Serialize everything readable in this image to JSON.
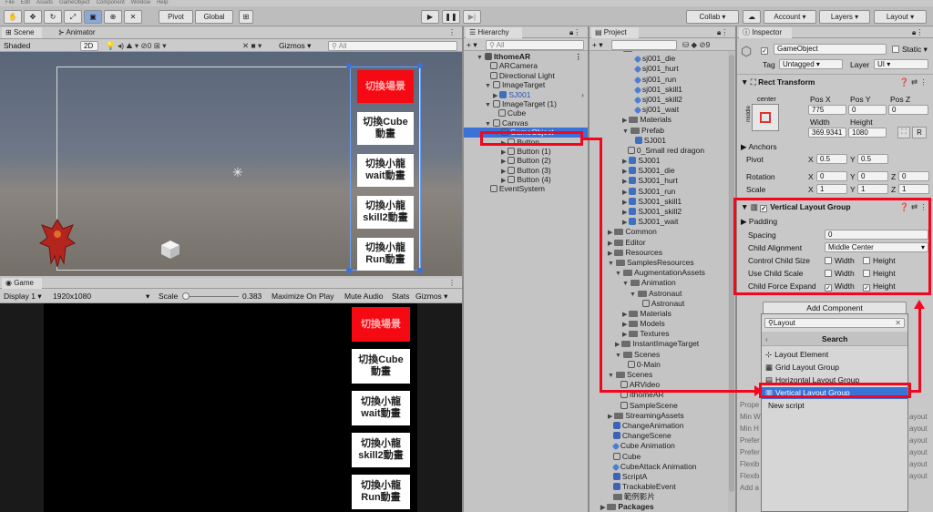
{
  "menubar": [
    "File",
    "Edit",
    "Assets",
    "GameObject",
    "Component",
    "Window",
    "Help"
  ],
  "toolbar": {
    "pivot": "Pivot",
    "global": "Global",
    "collab": "Collab ▾",
    "account": "Account ▾",
    "layers": "Layers ▾",
    "layout": "Layout ▾"
  },
  "scene_panel": {
    "tab_scene": "Scene",
    "tab_animator": "Animator",
    "shading": "Shaded",
    "mode_2d": "2D",
    "gizmos": "Gizmos ▾",
    "search_placeholder": "All",
    "buttons": [
      {
        "label": "切換場景",
        "red": true
      },
      {
        "label": "切換Cube\n動畫",
        "red": false
      },
      {
        "label": "切換小龍\nwait動畫",
        "red": false
      },
      {
        "label": "切換小龍\nskill2動畫",
        "red": false
      },
      {
        "label": "切換小龍\nRun動畫",
        "red": false
      }
    ]
  },
  "game_panel": {
    "tab": "Game",
    "display": "Display 1 ▾",
    "resolution": "1920x1080",
    "scale_label": "Scale",
    "scale_value": "0.383",
    "maximize": "Maximize On Play",
    "mute": "Mute Audio",
    "stats": "Stats",
    "gizmos": "Gizmos ▾",
    "buttons": [
      {
        "label": "切換場景",
        "red": true
      },
      {
        "label": "切換Cube\n動畫",
        "red": false
      },
      {
        "label": "切換小龍\nwait動畫",
        "red": false
      },
      {
        "label": "切換小龍\nskill2動畫",
        "red": false
      },
      {
        "label": "切換小龍\nRun動畫",
        "red": false
      }
    ]
  },
  "hierarchy": {
    "tab": "Hierarchy",
    "search_placeholder": "All",
    "items": [
      {
        "label": "IthomeAR",
        "indent": 0,
        "icon": "unity-scene-icon",
        "arrow": "▼",
        "bold": true
      },
      {
        "label": "ARCamera",
        "indent": 1,
        "icon": "gameobject-icon",
        "arrow": ""
      },
      {
        "label": "Directional Light",
        "indent": 1,
        "icon": "gameobject-icon",
        "arrow": ""
      },
      {
        "label": "ImageTarget",
        "indent": 1,
        "icon": "gameobject-icon",
        "arrow": "▼"
      },
      {
        "label": "SJ001",
        "indent": 2,
        "icon": "prefab-icon",
        "arrow": "▶",
        "blue": true
      },
      {
        "label": "ImageTarget (1)",
        "indent": 1,
        "icon": "gameobject-icon",
        "arrow": "▼"
      },
      {
        "label": "Cube",
        "indent": 2,
        "icon": "gameobject-icon",
        "arrow": ""
      },
      {
        "label": "Canvas",
        "indent": 1,
        "icon": "gameobject-icon",
        "arrow": "▼"
      },
      {
        "label": "GameObject",
        "indent": 2,
        "icon": "gameobject-icon",
        "arrow": "▼",
        "selected": true
      },
      {
        "label": "Button",
        "indent": 3,
        "icon": "gameobject-icon",
        "arrow": "▶"
      },
      {
        "label": "Button (1)",
        "indent": 3,
        "icon": "gameobject-icon",
        "arrow": "▶"
      },
      {
        "label": "Button (2)",
        "indent": 3,
        "icon": "gameobject-icon",
        "arrow": "▶"
      },
      {
        "label": "Button (3)",
        "indent": 3,
        "icon": "gameobject-icon",
        "arrow": "▶"
      },
      {
        "label": "Button (4)",
        "indent": 3,
        "icon": "gameobject-icon",
        "arrow": "▶"
      },
      {
        "label": "EventSystem",
        "indent": 1,
        "icon": "gameobject-icon",
        "arrow": ""
      }
    ]
  },
  "project": {
    "tab": "Project",
    "items": [
      {
        "label": "Animation",
        "indent": 2,
        "type": "folder",
        "arrow": "▼"
      },
      {
        "label": "sj001_die",
        "indent": 4,
        "type": "anim"
      },
      {
        "label": "sj001_hurt",
        "indent": 4,
        "type": "anim"
      },
      {
        "label": "sj001_run",
        "indent": 4,
        "type": "anim"
      },
      {
        "label": "sj001_skill1",
        "indent": 4,
        "type": "anim"
      },
      {
        "label": "sj001_skill2",
        "indent": 4,
        "type": "anim"
      },
      {
        "label": "sj001_wait",
        "indent": 4,
        "type": "anim"
      },
      {
        "label": "Materials",
        "indent": 3,
        "type": "folder",
        "arrow": "▶"
      },
      {
        "label": "Prefab",
        "indent": 3,
        "type": "folder",
        "arrow": "▼"
      },
      {
        "label": "SJ001",
        "indent": 4,
        "type": "cube"
      },
      {
        "label": "0_Small red dragon",
        "indent": 3,
        "type": "scene"
      },
      {
        "label": "SJ001",
        "indent": 3,
        "type": "cube",
        "arrow": "▶"
      },
      {
        "label": "SJ001_die",
        "indent": 3,
        "type": "cube",
        "arrow": "▶"
      },
      {
        "label": "SJ001_hurt",
        "indent": 3,
        "type": "cube",
        "arrow": "▶"
      },
      {
        "label": "SJ001_run",
        "indent": 3,
        "type": "cube",
        "arrow": "▶"
      },
      {
        "label": "SJ001_skill1",
        "indent": 3,
        "type": "cube",
        "arrow": "▶"
      },
      {
        "label": "SJ001_skill2",
        "indent": 3,
        "type": "cube",
        "arrow": "▶"
      },
      {
        "label": "SJ001_wait",
        "indent": 3,
        "type": "cube",
        "arrow": "▶"
      },
      {
        "label": "Common",
        "indent": 1,
        "type": "folder",
        "arrow": "▶"
      },
      {
        "label": "Editor",
        "indent": 1,
        "type": "folder",
        "arrow": "▶"
      },
      {
        "label": "Resources",
        "indent": 1,
        "type": "folder",
        "arrow": "▶"
      },
      {
        "label": "SamplesResources",
        "indent": 1,
        "type": "folder",
        "arrow": "▼"
      },
      {
        "label": "AugmentationAssets",
        "indent": 2,
        "type": "folder",
        "arrow": "▼"
      },
      {
        "label": "Animation",
        "indent": 3,
        "type": "folder",
        "arrow": "▼"
      },
      {
        "label": "Astronaut",
        "indent": 4,
        "type": "folder",
        "arrow": "▼"
      },
      {
        "label": "Astronaut",
        "indent": 5,
        "type": "scene"
      },
      {
        "label": "Materials",
        "indent": 3,
        "type": "folder",
        "arrow": "▶"
      },
      {
        "label": "Models",
        "indent": 3,
        "type": "folder",
        "arrow": "▶"
      },
      {
        "label": "Textures",
        "indent": 3,
        "type": "folder",
        "arrow": "▶"
      },
      {
        "label": "InstantImageTarget",
        "indent": 2,
        "type": "folder",
        "arrow": "▶"
      },
      {
        "label": "Scenes",
        "indent": 2,
        "type": "folder",
        "arrow": "▼"
      },
      {
        "label": "0-Main",
        "indent": 3,
        "type": "scene"
      },
      {
        "label": "Scenes",
        "indent": 1,
        "type": "folder",
        "arrow": "▼"
      },
      {
        "label": "ARVideo",
        "indent": 2,
        "type": "scene"
      },
      {
        "label": "IthomeAR",
        "indent": 2,
        "type": "scene"
      },
      {
        "label": "SampleScene",
        "indent": 2,
        "type": "scene"
      },
      {
        "label": "StreamingAssets",
        "indent": 1,
        "type": "folder",
        "arrow": "▶"
      },
      {
        "label": "ChangeAnimation",
        "indent": 1,
        "type": "script"
      },
      {
        "label": "ChangeScene",
        "indent": 1,
        "type": "script"
      },
      {
        "label": "Cube Animation",
        "indent": 1,
        "type": "anim"
      },
      {
        "label": "Cube",
        "indent": 1,
        "type": "scene"
      },
      {
        "label": "CubeAttack Animation",
        "indent": 1,
        "type": "anim"
      },
      {
        "label": "ScriptA",
        "indent": 1,
        "type": "script"
      },
      {
        "label": "TrackableEvent",
        "indent": 1,
        "type": "script"
      },
      {
        "label": "範例影片",
        "indent": 1,
        "type": "video"
      },
      {
        "label": "Packages",
        "indent": 0,
        "type": "folder",
        "arrow": "▶",
        "bold": true
      }
    ]
  },
  "inspector": {
    "tab": "Inspector",
    "object_name": "GameObject",
    "static_label": "Static ▾",
    "tag_label": "Tag",
    "tag_value": "Untagged",
    "layer_label": "Layer",
    "layer_value": "UI",
    "rect_transform": {
      "title": "Rect Transform",
      "anchor_label": "center",
      "side_label": "middle",
      "pos_x_label": "Pos X",
      "pos_x": "775",
      "pos_y_label": "Pos Y",
      "pos_y": "0",
      "pos_z_label": "Pos Z",
      "pos_z": "0",
      "width_label": "Width",
      "width": "369.9341",
      "height_label": "Height",
      "height": "1080",
      "r_label": "R",
      "anchors": "Anchors",
      "pivot": "Pivot",
      "pivot_x": "0.5",
      "pivot_y": "0.5",
      "rotation": "Rotation",
      "rot_x": "0",
      "rot_y": "0",
      "rot_z": "0",
      "scale": "Scale",
      "scale_x": "1",
      "scale_y": "1",
      "scale_z": "1"
    },
    "vlg": {
      "title": "Vertical Layout Group",
      "padding": "Padding",
      "spacing_label": "Spacing",
      "spacing": "0",
      "child_alignment_label": "Child Alignment",
      "child_alignment": "Middle Center",
      "control_child_size": "Control Child Size",
      "use_child_scale": "Use Child Scale",
      "child_force_expand": "Child Force Expand",
      "width": "Width",
      "height": "Height"
    },
    "add_component": "Add Component",
    "search_value": "Layout",
    "search_title": "Search",
    "results": [
      "Layout Element",
      "Grid Layout Group",
      "Horizontal Layout Group",
      "Vertical Layout Group",
      "New script"
    ],
    "behind_labels": [
      "Prope",
      "Min W",
      "Min H",
      "Prefer",
      "Prefer",
      "Flexib",
      "Flexib",
      "Add a"
    ],
    "behind_right": [
      "ayout",
      "ayout",
      "ayout",
      "ayout",
      "ayout",
      "ayout"
    ]
  },
  "colors": {
    "annotation": "#f2071f",
    "selection": "#3a72d8"
  }
}
